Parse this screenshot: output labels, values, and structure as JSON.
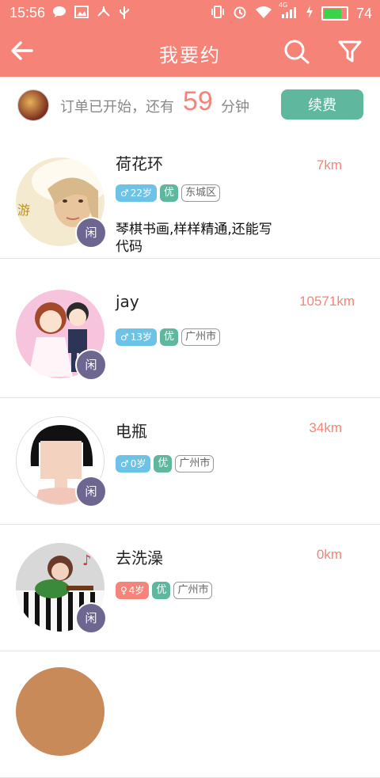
{
  "status": {
    "time": "15:56",
    "battery_level": 74,
    "battery_text": "74",
    "network": "4G",
    "left_icons": [
      "chat-icon",
      "image-icon",
      "usb-share-icon",
      "usb-icon"
    ],
    "right_icons": [
      "vibrate-icon",
      "alarm-icon",
      "wifi-icon",
      "signal-icon",
      "charging-icon"
    ]
  },
  "header": {
    "title": "我要约",
    "back_icon": "arrow-left-icon",
    "search_icon": "search-icon",
    "filter_icon": "filter-icon"
  },
  "order": {
    "message": "订单已开始，还有",
    "minutes": "59",
    "unit": "分钟",
    "renew_label": "续费"
  },
  "colors": {
    "primary": "#f58378",
    "accent_green": "#5fb79e",
    "male_blue": "#6dc2e8",
    "female_pink": "#f5847a",
    "idle_purple": "#6c6690"
  },
  "users": [
    {
      "name": "荷花环",
      "distance": "7km",
      "gender": "male",
      "gender_symbol": "♂",
      "age": "22岁",
      "level": "优",
      "city": "东城区",
      "status": "闲",
      "description": "琴棋书画,样样精通,还能写代码"
    },
    {
      "name": "jay",
      "distance": "10571km",
      "gender": "male",
      "gender_symbol": "♂",
      "age": "13岁",
      "level": "优",
      "city": "广州市",
      "status": "闲",
      "description": ""
    },
    {
      "name": "电瓶",
      "distance": "34km",
      "gender": "male",
      "gender_symbol": "♂",
      "age": "0岁",
      "level": "优",
      "city": "广州市",
      "status": "闲",
      "description": ""
    },
    {
      "name": "去洗澡",
      "distance": "0km",
      "gender": "female",
      "gender_symbol": "♀",
      "age": "4岁",
      "level": "优",
      "city": "广州市",
      "status": "闲",
      "description": ""
    },
    {
      "name": "",
      "distance": "",
      "gender": "",
      "gender_symbol": "",
      "age": "",
      "level": "",
      "city": "",
      "status": "",
      "description": ""
    }
  ]
}
